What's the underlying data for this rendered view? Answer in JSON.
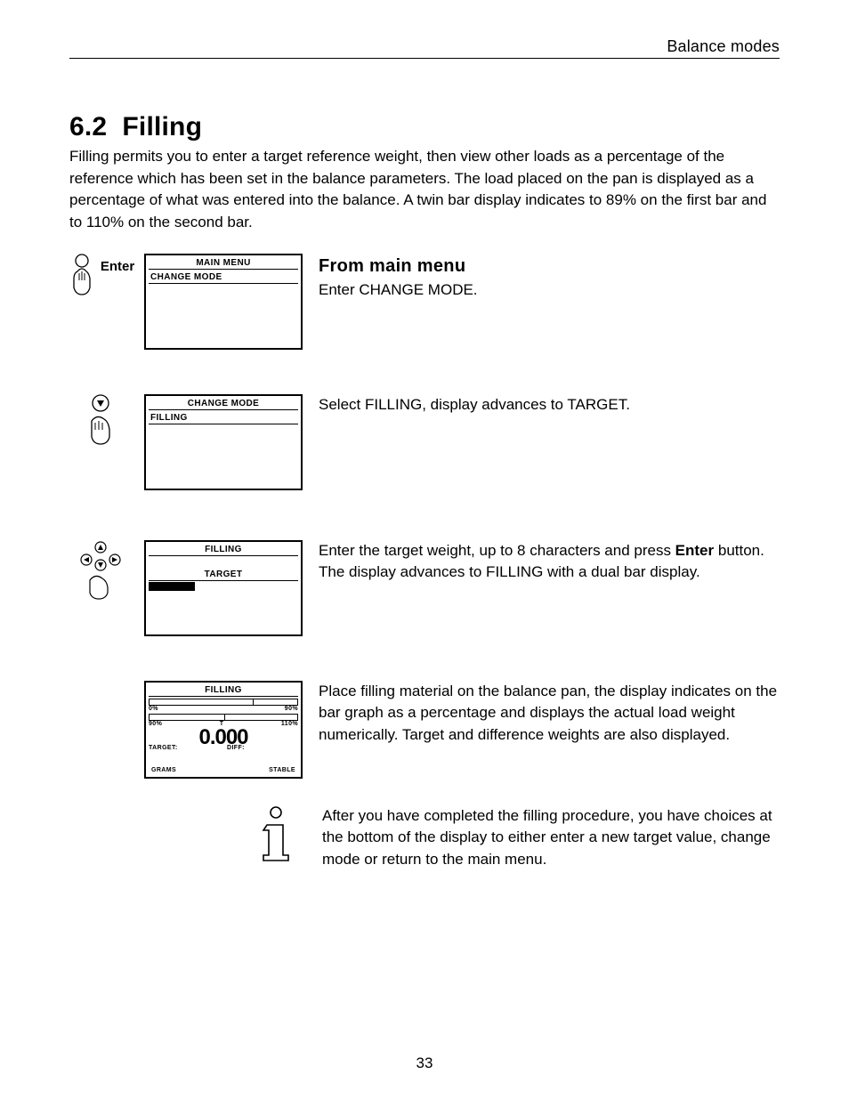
{
  "header": "Balance modes",
  "section": {
    "number": "6.2",
    "title": "Filling",
    "intro": "Filling permits you to enter a target reference weight, then view other loads as a percentage of the reference which has been set in the balance parameters.  The load placed on the pan is displayed as a percentage of what was entered into the balance.  A twin bar display indicates to 89% on the first bar and to 110% on the second bar."
  },
  "steps": [
    {
      "iconLabel": "Enter",
      "lcd": {
        "title": "MAIN MENU",
        "row1": "CHANGE MODE"
      },
      "heading": "From main menu",
      "text": "Enter CHANGE MODE."
    },
    {
      "lcd": {
        "title": "CHANGE MODE",
        "row1": "FILLING"
      },
      "text": "Select FILLING, display advances to TARGET."
    },
    {
      "lcd": {
        "title": "FILLING",
        "sub": "TARGET"
      },
      "textPre": "Enter the target weight, up to 8 characters and press ",
      "textBold": "Enter",
      "textPost": " button.  The display advances to FILLING with a dual bar display."
    },
    {
      "lcd": {
        "title": "FILLING",
        "bar1": {
          "left": "0%",
          "right": "90%"
        },
        "bar2": {
          "left": "90%",
          "mid": "T",
          "right": "110%"
        },
        "value": "0.000",
        "target": "TARGET:",
        "diff": "DIFF:",
        "unit": "GRAMS",
        "status": "STABLE"
      },
      "text": "Place filling material on the balance pan, the display indicates on the bar graph as a percentage and displays the actual load weight numerically. Target and difference weights are also displayed."
    },
    {
      "text": "After you have completed the filling procedure, you have choices at the bottom of the display to either enter a new target value, change mode or return to the main menu."
    }
  ],
  "pageNumber": "33"
}
